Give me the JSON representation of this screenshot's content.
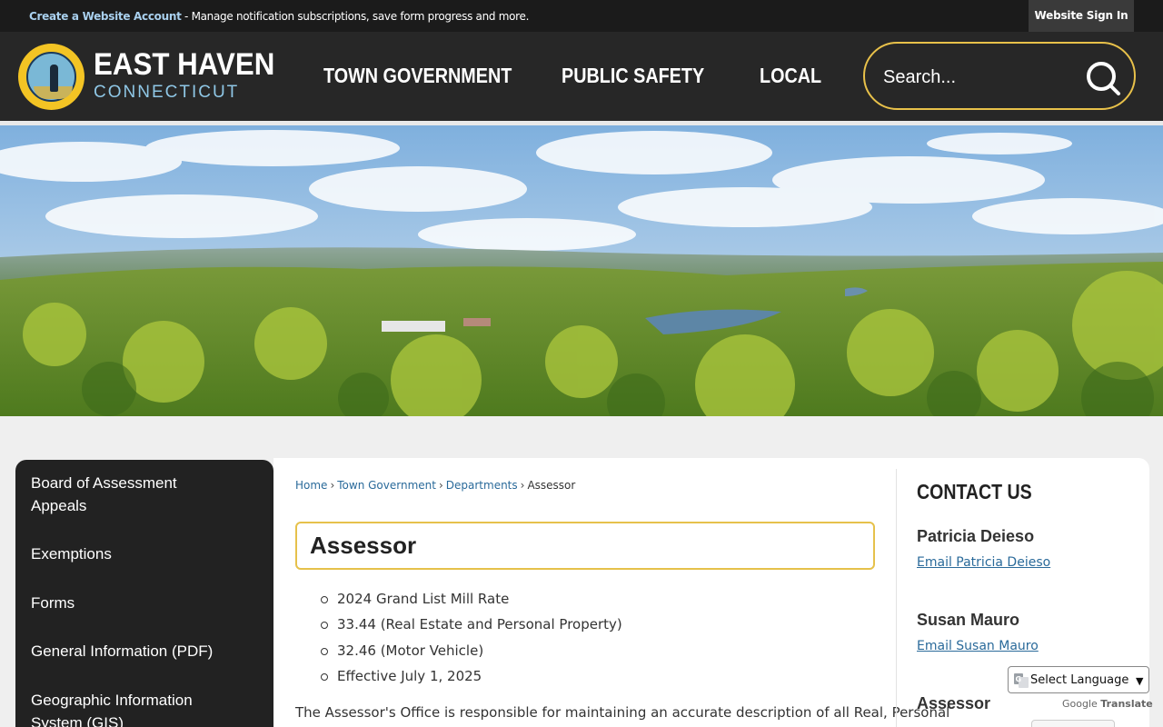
{
  "topbar": {
    "create_account_link": "Create a Website Account",
    "message": " - Manage notification subscriptions, save form progress and more.",
    "signin_label": "Website Sign In"
  },
  "header": {
    "logo_name": "EAST HAVEN",
    "logo_sub": "CONNECTICUT",
    "nav": [
      "TOWN GOVERNMENT",
      "PUBLIC SAFETY",
      "LOCAL"
    ],
    "search_placeholder": "Search..."
  },
  "sidebar": {
    "items": [
      {
        "label": "Board of Assessment Appeals"
      },
      {
        "label": "Exemptions"
      },
      {
        "label": "Forms"
      },
      {
        "label": "General Information (PDF)"
      },
      {
        "label": "Geographic Information System (GIS)"
      }
    ]
  },
  "breadcrumb": {
    "items": [
      "Home",
      "Town Government",
      "Departments"
    ],
    "current": "Assessor"
  },
  "main": {
    "title": "Assessor",
    "bullets": [
      "2024 Grand List Mill Rate",
      "33.44 (Real Estate and Personal Property)",
      "32.46 (Motor Vehicle)",
      "Effective July 1, 2025"
    ],
    "paragraph": "The Assessor's Office is responsible for maintaining an accurate description of all Real, Personal"
  },
  "contact": {
    "title": "CONTACT US",
    "people": [
      {
        "name": "Patricia Deieso",
        "email_label": "Email Patricia Deieso"
      },
      {
        "name": "Susan Mauro",
        "email_label": "Email Susan Mauro"
      }
    ],
    "section": "Assessor"
  },
  "translate": {
    "select_label": "Select Language",
    "powered_google": "Google",
    "powered_translate": "Translate"
  },
  "colors": {
    "header_bg": "#272727",
    "accent_gold": "#e8c14a",
    "link_blue": "#2a6a9a",
    "logo_sub_blue": "#8fc7e6"
  }
}
